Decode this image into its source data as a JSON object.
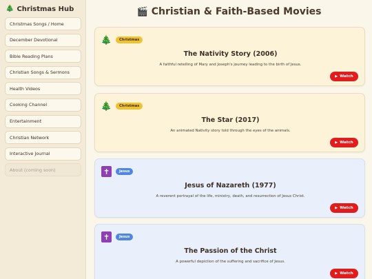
{
  "sidebar": {
    "brand": {
      "icon": "christmas-tree-icon",
      "icon_glyph": "🎄",
      "title": "Christmas Hub"
    },
    "items": [
      {
        "label": "Christmas Songs / Home",
        "disabled": false
      },
      {
        "label": "December Devotional",
        "disabled": false
      },
      {
        "label": "Bible Reading Plans",
        "disabled": false
      },
      {
        "label": "Christian Songs & Sermons",
        "disabled": false
      },
      {
        "label": "Health Videos",
        "disabled": false
      },
      {
        "label": "Cooking Channel",
        "disabled": false
      },
      {
        "label": "Entertainment",
        "disabled": false
      },
      {
        "label": "Christian Network",
        "disabled": false
      },
      {
        "label": "Interactive Journal",
        "disabled": false
      },
      {
        "label": "About (coming soon)",
        "disabled": true
      }
    ]
  },
  "main": {
    "title_icon": "clapperboard-icon",
    "title_glyph": "🎬",
    "title": "Christian & Faith-Based Movies",
    "watch_label": "Watch",
    "cards": [
      {
        "category": "Christmas",
        "icon": "christmas-tree-icon",
        "icon_glyph": "🎄",
        "title": "The Nativity Story (2006)",
        "description": "A faithful retelling of Mary and Joseph's journey leading to the birth of Jesus."
      },
      {
        "category": "Christmas",
        "icon": "christmas-tree-icon",
        "icon_glyph": "🎄",
        "title": "The Star (2017)",
        "description": "An animated Nativity story told through the eyes of the animals."
      },
      {
        "category": "Jesus",
        "icon": "cross-icon",
        "icon_glyph": "✝",
        "title": "Jesus of Nazareth (1977)",
        "description": "A reverent portrayal of the life, ministry, death, and resurrection of Jesus Christ."
      },
      {
        "category": "Jesus",
        "icon": "cross-icon",
        "icon_glyph": "✝",
        "title": "The Passion of the Christ",
        "description": "A powerful depiction of the suffering and sacrifice of Jesus."
      }
    ]
  },
  "colors": {
    "christmas_card_bg": "#fdf3d9",
    "jesus_card_bg": "#e9f0fb",
    "christmas_badge": "#f2c22e",
    "jesus_badge": "#4f86df",
    "watch_button": "#e11c1c",
    "cross_icon_bg": "#8e3fb5"
  }
}
